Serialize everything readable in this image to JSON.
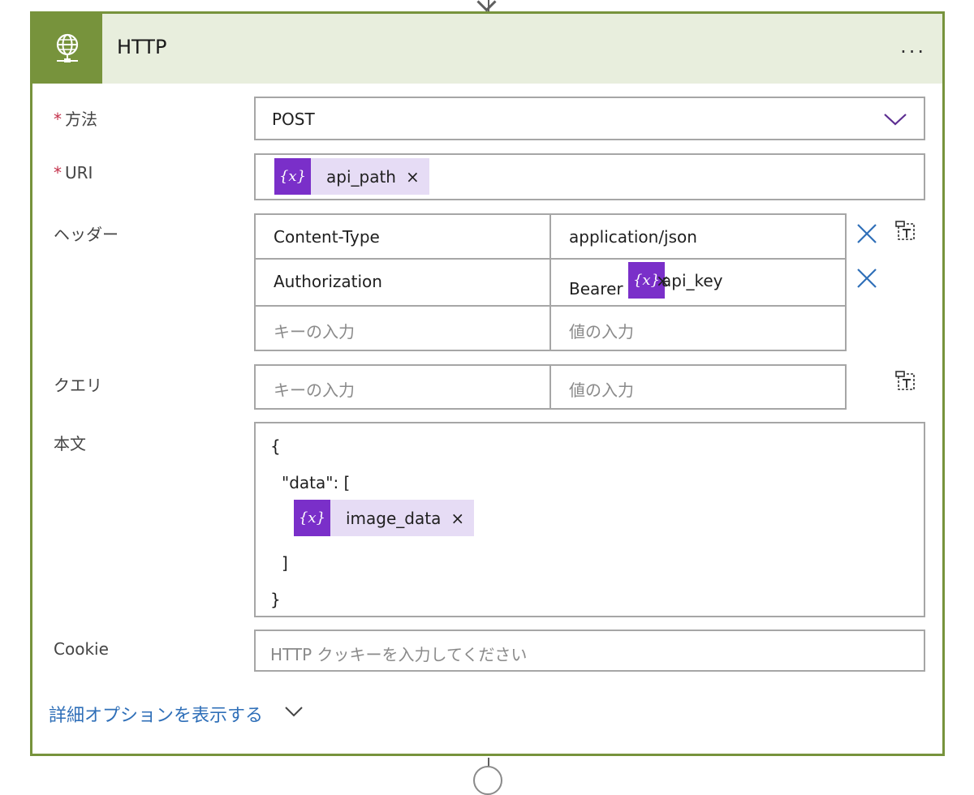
{
  "action": {
    "title": "HTTP",
    "more_label": "...",
    "icon": "globe-icon",
    "accent_color": "#77933c",
    "header_bg": "#e8eedd"
  },
  "method": {
    "label": "方法",
    "required_mark": "*",
    "value": "POST",
    "icon": "chevron-down-icon"
  },
  "uri": {
    "label": "URI",
    "required_mark": "*",
    "token": {
      "icon_text": "{x}",
      "label": "api_path",
      "remove": "×"
    }
  },
  "headers": {
    "label": "ヘッダー",
    "rows": [
      {
        "key": "Content-Type",
        "value": "application/json"
      },
      {
        "key": "Authorization",
        "value_prefix": "Bearer",
        "token": {
          "icon_text": "{x}",
          "label": "api_key",
          "remove": "×"
        }
      }
    ],
    "key_placeholder": "キーの入力",
    "value_placeholder": "値の入力"
  },
  "query": {
    "label": "クエリ",
    "key_placeholder": "キーの入力",
    "value_placeholder": "値の入力"
  },
  "body": {
    "label": "本文",
    "lines": [
      "{",
      "\"data\": [",
      "]",
      "}"
    ],
    "token": {
      "icon_text": "{x}",
      "label": "image_data",
      "remove": "×"
    }
  },
  "cookie": {
    "label": "Cookie",
    "placeholder": "HTTP クッキーを入力してください"
  },
  "advanced": {
    "label": "詳細オプションを表示する",
    "icon": "chevron-down-icon"
  },
  "colors": {
    "token_bg": "#e6dcf5",
    "token_icon_bg": "#7a2fc9",
    "link": "#2f6fb8",
    "delete_icon": "#2f6fb8",
    "required": "#c4314b"
  }
}
